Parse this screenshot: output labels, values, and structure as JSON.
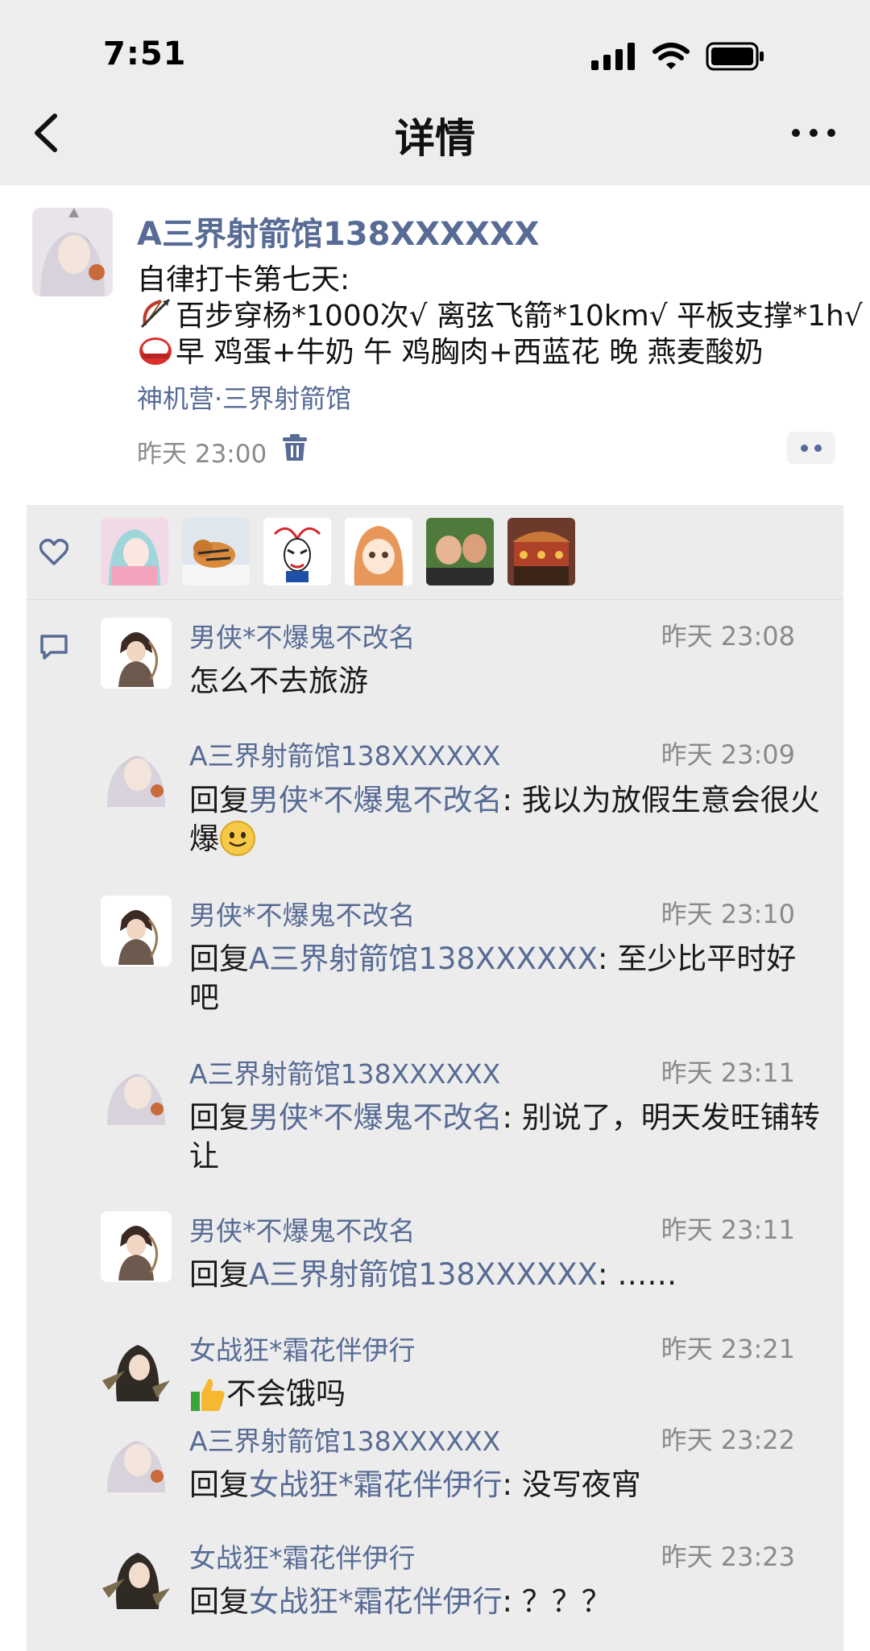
{
  "status": {
    "time": "7:51"
  },
  "nav": {
    "title": "详情"
  },
  "post": {
    "author": "A三界射箭馆138XXXXXX",
    "lines": [
      "自律打卡第七天:",
      "百步穿杨*1000次√ 离弦飞箭*10km√ 平板支撑*1h√",
      "早 鸡蛋+牛奶 午 鸡胸肉+西蓝花 晚 燕麦酸奶"
    ],
    "location": "神机营·三界射箭馆",
    "time": "昨天 23:00"
  },
  "comments": [
    {
      "name": "男侠*不爆鬼不改名",
      "time": "昨天 23:08",
      "reply_prefix": "",
      "reply_to": "",
      "text": "怎么不去旅游"
    },
    {
      "name": "A三界射箭馆138XXXXXX",
      "time": "昨天 23:09",
      "reply_prefix": "回复",
      "reply_to": "男侠*不爆鬼不改名",
      "text": ": 我以为放假生意会很火爆"
    },
    {
      "name": "男侠*不爆鬼不改名",
      "time": "昨天 23:10",
      "reply_prefix": "回复",
      "reply_to": "A三界射箭馆138XXXXXX",
      "text": ": 至少比平时好吧"
    },
    {
      "name": "A三界射箭馆138XXXXXX",
      "time": "昨天 23:11",
      "reply_prefix": "回复",
      "reply_to": "男侠*不爆鬼不改名",
      "text": ": 别说了，明天发旺铺转让"
    },
    {
      "name": "男侠*不爆鬼不改名",
      "time": "昨天 23:11",
      "reply_prefix": "回复",
      "reply_to": "A三界射箭馆138XXXXXX",
      "text": ": ……"
    },
    {
      "name": "女战狂*霜花伴伊行",
      "time": "昨天 23:21",
      "reply_prefix": "",
      "reply_to": "",
      "text": "不会饿吗"
    },
    {
      "name": "A三界射箭馆138XXXXXX",
      "time": "昨天 23:22",
      "reply_prefix": "回复",
      "reply_to": "女战狂*霜花伴伊行",
      "text": ": 没写夜宵"
    },
    {
      "name": "女战狂*霜花伴伊行",
      "time": "昨天 23:23",
      "reply_prefix": "回复",
      "reply_to": "女战狂*霜花伴伊行",
      "text": ": ？？？"
    }
  ],
  "icons": {
    "like": "heart-outline-icon",
    "comment": "speech-bubble-icon",
    "delete": "trash-icon",
    "back": "chevron-left-icon",
    "more": "ellipsis-icon"
  },
  "colors": {
    "link": "#576b95",
    "background": "#ededed",
    "panel": "#ececec"
  }
}
